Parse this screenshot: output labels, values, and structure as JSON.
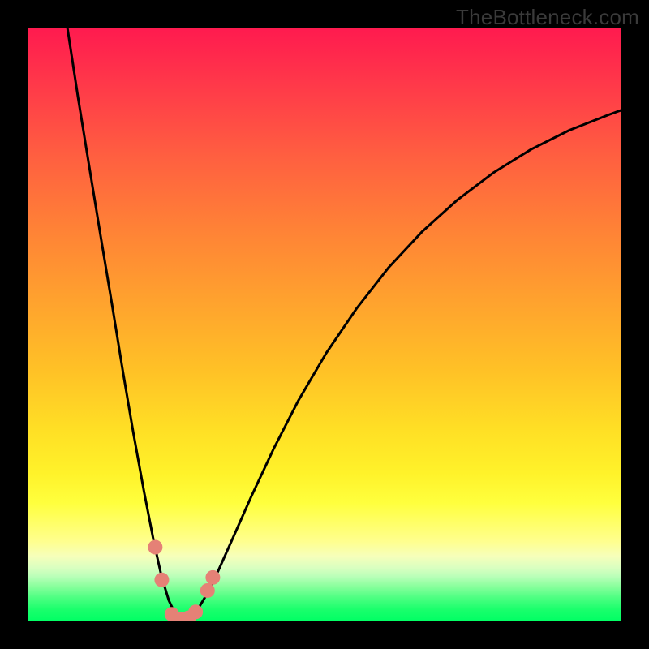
{
  "watermark": {
    "text": "TheBottleneck.com"
  },
  "chart_data": {
    "type": "line",
    "title": "",
    "xlabel": "",
    "ylabel": "",
    "xlim": [
      0,
      100
    ],
    "ylim": [
      0,
      100
    ],
    "grid": false,
    "legend": false,
    "background": "rainbow-vertical",
    "series": [
      {
        "name": "bottleneck-curve",
        "x": [
          6.7,
          8.5,
          10.4,
          12.3,
          14.2,
          16,
          17.8,
          19.6,
          21.3,
          22.6,
          23.8,
          24.8,
          25.6,
          26.4,
          27.6,
          28.7,
          30.2,
          32.1,
          34.6,
          37.7,
          41.4,
          45.6,
          50.3,
          55.4,
          60.8,
          66.5,
          72.4,
          78.5,
          84.8,
          91.2,
          97.8,
          100
        ],
        "y": [
          100,
          88.2,
          76.5,
          64.9,
          53.5,
          42.4,
          31.8,
          21.9,
          13.2,
          7.4,
          3.5,
          1.4,
          0.4,
          0.3,
          0.8,
          2.1,
          4.6,
          8.5,
          14.1,
          21.1,
          29,
          37.2,
          45.2,
          52.7,
          59.6,
          65.7,
          71,
          75.6,
          79.5,
          82.7,
          85.3,
          86.1
        ]
      }
    ],
    "markers": [
      {
        "name": "left-upper-pair",
        "x": 21.5,
        "y": 12.5,
        "color": "#e58176"
      },
      {
        "name": "left-lower-pair",
        "x": 22.6,
        "y": 7.0,
        "color": "#e58176"
      },
      {
        "name": "trough-a",
        "x": 24.3,
        "y": 1.2,
        "color": "#e58176"
      },
      {
        "name": "trough-b",
        "x": 25.7,
        "y": 0.4,
        "color": "#e58176"
      },
      {
        "name": "trough-c",
        "x": 27.1,
        "y": 0.6,
        "color": "#e58176"
      },
      {
        "name": "trough-d",
        "x": 28.3,
        "y": 1.6,
        "color": "#e58176"
      },
      {
        "name": "right-lower-pair",
        "x": 30.3,
        "y": 5.2,
        "color": "#e58176"
      },
      {
        "name": "right-upper-pair",
        "x": 31.2,
        "y": 7.4,
        "color": "#e58176"
      }
    ]
  }
}
